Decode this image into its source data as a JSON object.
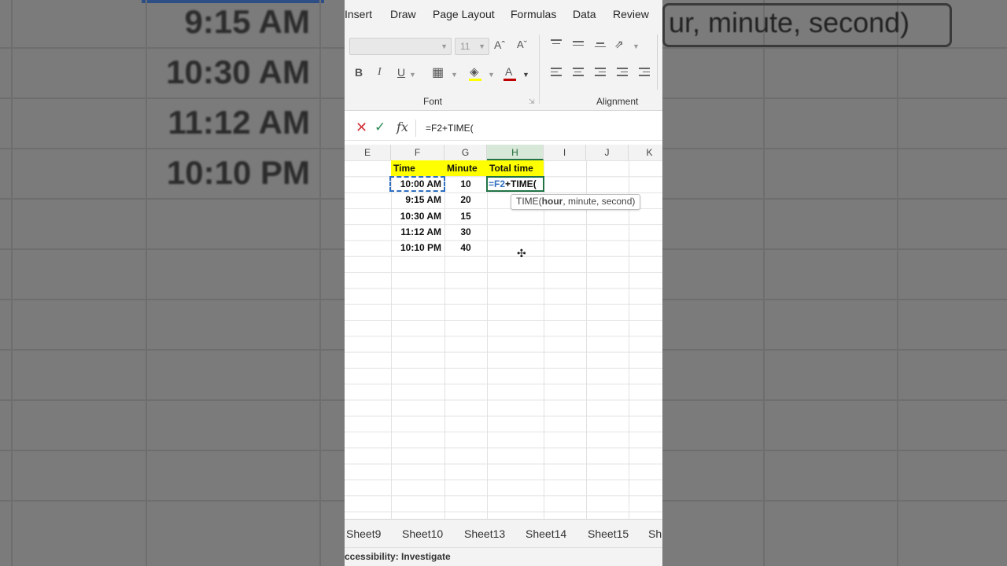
{
  "background": {
    "times": [
      "9:15 AM",
      "10:30 AM",
      "11:12 AM",
      "10:10 PM"
    ],
    "tooltip_fragment": "ur, minute, second)"
  },
  "menu": {
    "items": [
      "Insert",
      "Draw",
      "Page Layout",
      "Formulas",
      "Data",
      "Review"
    ]
  },
  "ribbon": {
    "font_size": "11",
    "bold_label": "B",
    "italic_label": "I",
    "underline_label": "U",
    "grow_font_label": "Aˆ",
    "shrink_font_label": "Aˇ",
    "font_color_label": "A",
    "groups": {
      "font": "Font",
      "alignment": "Alignment"
    }
  },
  "formula_bar": {
    "cancel_label": "✕",
    "enter_label": "✓",
    "fx_label": "fx",
    "value": "=F2+TIME("
  },
  "columns": [
    "E",
    "F",
    "G",
    "H",
    "I",
    "J",
    "K"
  ],
  "table": {
    "headers": {
      "time": "Time",
      "minute": "Minute",
      "total": "Total time"
    },
    "rows": [
      {
        "time": "10:00 AM",
        "minute": "10"
      },
      {
        "time": "9:15 AM",
        "minute": "20"
      },
      {
        "time": "10:30 AM",
        "minute": "15"
      },
      {
        "time": "11:12 AM",
        "minute": "30"
      },
      {
        "time": "10:10 PM",
        "minute": "40"
      }
    ],
    "active_cell": {
      "ref": "=F2",
      "rest": "+TIME("
    }
  },
  "tooltip": {
    "fn": "TIME(",
    "arg": "hour",
    "rest": ", minute, second)"
  },
  "sheet_tabs": [
    "Sheet9",
    "Sheet10",
    "Sheet13",
    "Sheet14",
    "Sheet15",
    "Sh"
  ],
  "status": {
    "text": "ccessibility: Investigate"
  }
}
